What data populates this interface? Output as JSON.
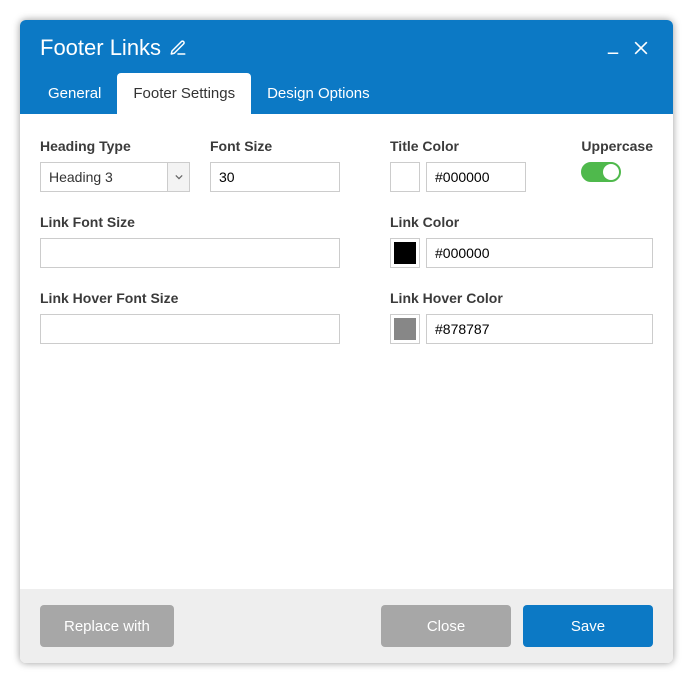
{
  "dialog": {
    "title": "Footer Links"
  },
  "tabs": [
    {
      "label": "General"
    },
    {
      "label": "Footer Settings"
    },
    {
      "label": "Design Options"
    }
  ],
  "fields": {
    "heading_type": {
      "label": "Heading Type",
      "value": "Heading 3"
    },
    "font_size": {
      "label": "Font Size",
      "value": "30"
    },
    "title_color": {
      "label": "Title Color",
      "value": "#000000",
      "swatch": "#000000"
    },
    "uppercase": {
      "label": "Uppercase",
      "value": true
    },
    "link_font_size": {
      "label": "Link Font Size",
      "value": ""
    },
    "link_color": {
      "label": "Link Color",
      "value": "#000000",
      "swatch": "#000000"
    },
    "link_hover_font_size": {
      "label": "Link Hover Font Size",
      "value": ""
    },
    "link_hover_color": {
      "label": "Link Hover Color",
      "value": "#878787",
      "swatch": "#878787"
    }
  },
  "footer": {
    "replace": "Replace with",
    "close": "Close",
    "save": "Save"
  }
}
